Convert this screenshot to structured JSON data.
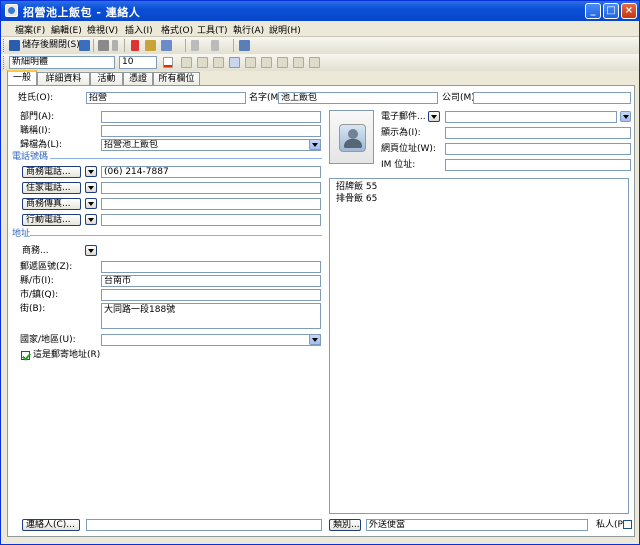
{
  "window": {
    "title": "招營池上飯包 - 連絡人",
    "min": "_",
    "max": "□",
    "close": "×"
  },
  "menu": [
    "檔案(F)",
    "編輯(E)",
    "檢視(V)",
    "插入(I)",
    "格式(O)",
    "工具(T)",
    "執行(A)",
    "說明(H)"
  ],
  "toolbar": {
    "save_close": "儲存後關閉(S)",
    "font_name": "新細明體",
    "font_size": "10"
  },
  "tabs": [
    "一般",
    "詳細資料",
    "活動",
    "憑證",
    "所有欄位"
  ],
  "form": {
    "name_label": "姓氏(O):",
    "name_value": "招營",
    "first_label": "名字(M):",
    "first_value": "池上飯包",
    "company_label": "公司(M):",
    "company_value": "",
    "dept_label": "部門(A):",
    "title_label": "職稱(I):",
    "fileas_label": "歸檔為(L):",
    "fileas_value": "招營池上飯包",
    "phone_section": "電話號碼",
    "phones": [
      {
        "label": "商務電話...",
        "value": "(06) 214-7887"
      },
      {
        "label": "住家電話...",
        "value": ""
      },
      {
        "label": "商務傳真...",
        "value": ""
      },
      {
        "label": "行動電話...",
        "value": ""
      }
    ],
    "address_section": "地址",
    "addr_type": "商務...",
    "zip_label": "郵遞區號(Z):",
    "county_label": "縣/市(I):",
    "county_value": "台南市",
    "city_label": "市/鎮(Q):",
    "street_label": "街(B):",
    "street_value": "大同路一段188號",
    "country_label": "國家/地區(U):",
    "mailing_label": "這是郵寄地址(R)",
    "email_label": "電子郵件...",
    "display_label": "顯示為(I):",
    "web_label": "網頁位址(W):",
    "im_label": "IM 位址:",
    "notes": [
      "招牌飯  55",
      "排骨飯  65"
    ],
    "contacts_button": "連絡人(C)...",
    "categories_button": "類別...",
    "categories_value": "外送便當",
    "private_label": "私人(P)"
  }
}
